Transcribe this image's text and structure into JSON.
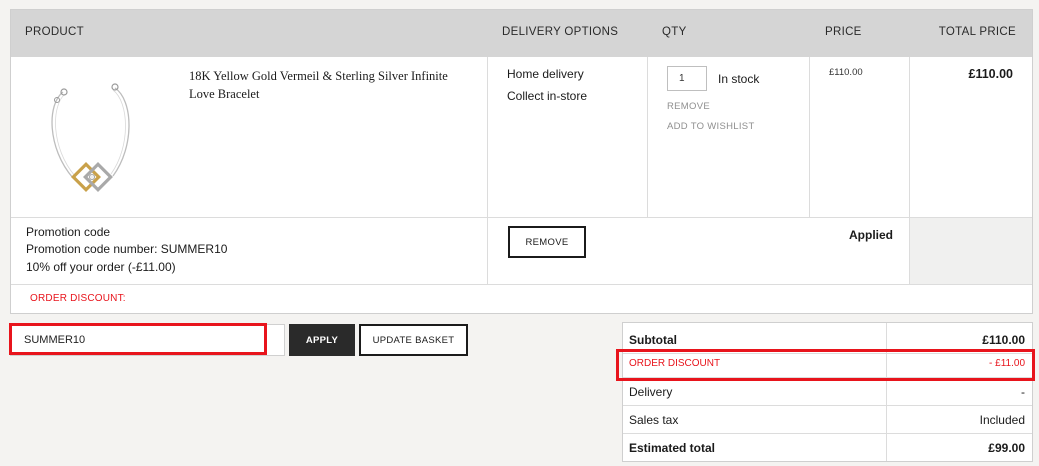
{
  "header": {
    "product": "PRODUCT",
    "delivery": "DELIVERY OPTIONS",
    "qty": "QTY",
    "price": "PRICE",
    "total": "TOTAL PRICE"
  },
  "item": {
    "name": "18K Yellow Gold Vermeil & Sterling Silver Infinite Love Bracelet",
    "delivery_options": [
      "Home delivery",
      "Collect in-store"
    ],
    "qty": "1",
    "stock": "In stock",
    "remove": "REMOVE",
    "wishlist": "ADD TO WISHLIST",
    "price": "£110.00",
    "total": "£110.00"
  },
  "promotion": {
    "title": "Promotion code",
    "code_line": "Promotion code number: SUMMER10",
    "desc": "10% off your order (-£11.00)",
    "remove_label": "REMOVE",
    "status": "Applied",
    "order_discount_label": "ORDER DISCOUNT:"
  },
  "promo_input": {
    "value": "SUMMER10"
  },
  "buttons": {
    "apply": "APPLY",
    "update": "UPDATE BASKET"
  },
  "summary": {
    "subtotal_label": "Subtotal",
    "subtotal": "£110.00",
    "discount_label": "ORDER DISCOUNT",
    "discount": "- £11.00",
    "delivery_label": "Delivery",
    "delivery": "-",
    "tax_label": "Sales tax",
    "tax": "Included",
    "estimated_label": "Estimated total",
    "estimated": "£99.00"
  },
  "colors": {
    "accent_red": "#e8141c",
    "header_gray": "#d5d5d5",
    "dark_button": "#2a2a2a"
  }
}
